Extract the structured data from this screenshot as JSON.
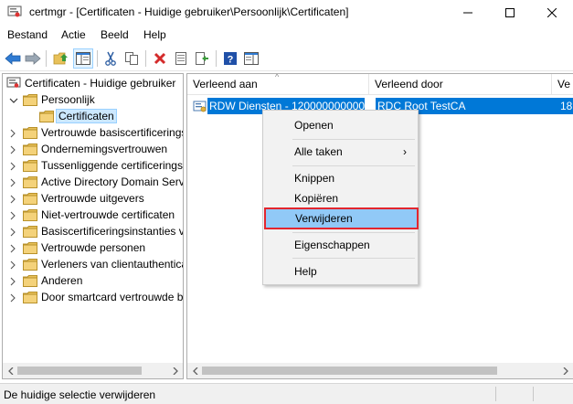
{
  "window": {
    "title": "certmgr - [Certificaten - Huidige gebruiker\\Persoonlijk\\Certificaten]"
  },
  "menubar": {
    "items": [
      "Bestand",
      "Actie",
      "Beeld",
      "Help"
    ]
  },
  "tree": {
    "root": "Certificaten - Huidige gebruiker",
    "items": [
      {
        "label": "Persoonlijk",
        "expanded": true
      },
      {
        "label": "Certificaten",
        "selected": true
      },
      {
        "label": "Vertrouwde basiscertificerings"
      },
      {
        "label": "Ondernemingsvertrouwen"
      },
      {
        "label": "Tussenliggende certificerings"
      },
      {
        "label": "Active Directory Domain Serv"
      },
      {
        "label": "Vertrouwde uitgevers"
      },
      {
        "label": "Niet-vertrouwde certificaten"
      },
      {
        "label": "Basiscertificeringsinstanties v"
      },
      {
        "label": "Vertrouwde personen"
      },
      {
        "label": "Verleners van clientauthentica"
      },
      {
        "label": "Anderen"
      },
      {
        "label": "Door smartcard vertrouwde b"
      }
    ]
  },
  "list": {
    "columns": [
      "Verleend aan",
      "Verleend door",
      "Ve"
    ],
    "rows": [
      {
        "issued_to": "RDW Diensten - 120000000000H",
        "issued_by": "RDC Root TestCA",
        "col3": "18"
      }
    ]
  },
  "context_menu": {
    "items": [
      "Openen",
      "Alle taken",
      "Knippen",
      "Kopiëren",
      "Verwijderen",
      "Eigenschappen",
      "Help"
    ],
    "highlighted": "Verwijderen",
    "submenu_glyph": "›"
  },
  "status": {
    "text": "De huidige selectie verwijderen"
  },
  "colors": {
    "selection": "#0078d7",
    "menu_highlight": "#91c9f7",
    "highlight_border": "#e3262e",
    "folder": "#e8c15a"
  }
}
